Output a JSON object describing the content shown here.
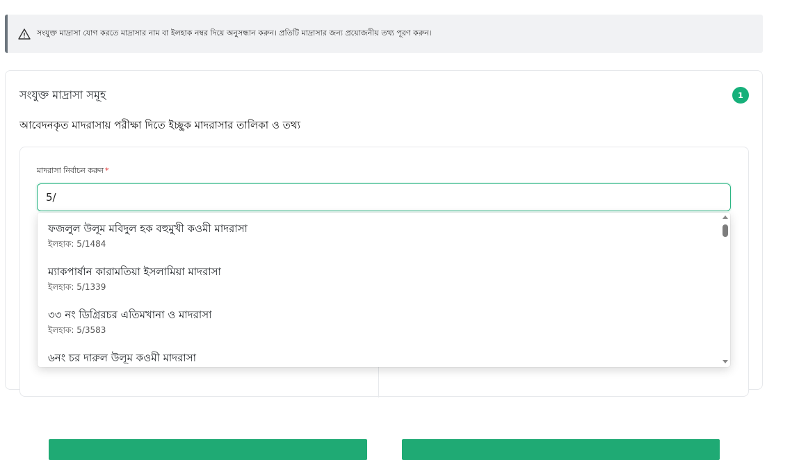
{
  "alert": {
    "icon": "warning-triangle-icon",
    "text": "সংযুক্ত মাদ্রাসা যোগ করতে মাদ্রাসার নাম বা ইলহাক নম্বর দিয়ে অনুসন্ধান করুন। প্রতিটি মাদ্রাসার জন্য প্রয়োজনীয় তথ্য পূরণ করুন।"
  },
  "card": {
    "title": "সংযুক্ত মাদ্রাসা সমূহ",
    "count_badge": "1",
    "subtitle": "আবেদনকৃত মাদরাসায় পরীক্ষা দিতে ইচ্ছুক মাদরাসার তালিকা ও তথ্য"
  },
  "field": {
    "label": "মাদরাসা নির্বাচন করুন",
    "required_mark": "*",
    "value": "5/"
  },
  "dropdown": {
    "options": [
      {
        "name": "ফজলুল উলূম মবিদুল হক বহুমুখী কওমী মাদরাসা",
        "code": "ইলহাক: 5/1484"
      },
      {
        "name": "ম্যাকপার্ষান কারামতিয়া ইসলামিয়া মাদরাসা",
        "code": "ইলহাক: 5/1339"
      },
      {
        "name": "৩৩ নং ডিগ্রিরচর এতিমখানা ও মাদরাসা",
        "code": "ইলহাক: 5/3583"
      },
      {
        "name": "৬নং চর দারুল উলূম কওমী মাদরাসা",
        "code": ""
      }
    ]
  },
  "colors": {
    "accent": "#16b07a",
    "alert_bg": "#f1f2f4",
    "required": "#e03131"
  }
}
